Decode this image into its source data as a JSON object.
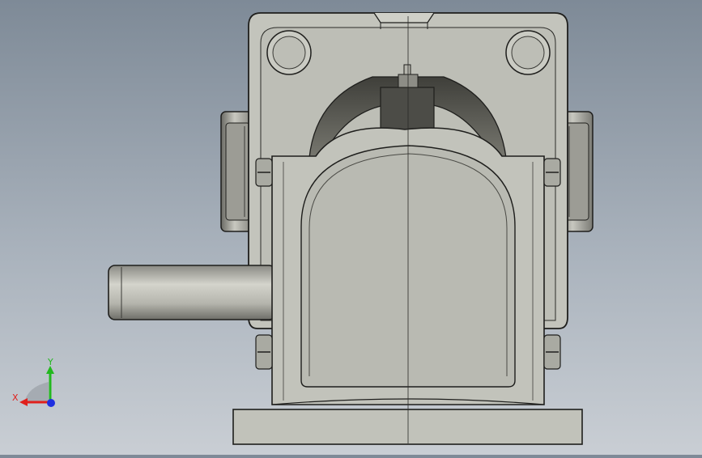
{
  "viewport": {
    "background_top": "#7e8a97",
    "background_bottom": "#c9ced4",
    "part_fill": "#c4c5bd",
    "part_dark": "#55554f",
    "edge_color": "#1e1e1c"
  },
  "triad": {
    "x_label": "X",
    "y_label": "Y",
    "x_color": "#e0201c",
    "y_color": "#22b81e",
    "z_color": "#1f2fe0"
  }
}
